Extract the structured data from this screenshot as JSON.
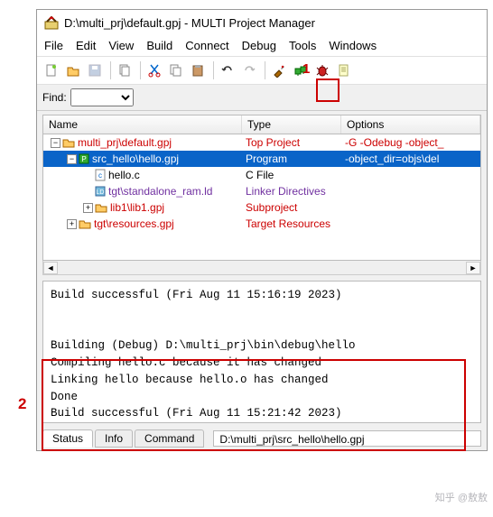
{
  "title": "D:\\multi_prj\\default.gpj - MULTI Project Manager",
  "menus": [
    "File",
    "Edit",
    "View",
    "Build",
    "Connect",
    "Debug",
    "Tools",
    "Windows"
  ],
  "toolbar_icons": [
    {
      "name": "new-file-icon",
      "disabled": false
    },
    {
      "name": "open-icon",
      "disabled": false
    },
    {
      "name": "save-icon",
      "disabled": true
    },
    {
      "name": "sep"
    },
    {
      "name": "copy-doc-icon",
      "disabled": false
    },
    {
      "name": "sep"
    },
    {
      "name": "cut-icon",
      "disabled": false
    },
    {
      "name": "copy-icon",
      "disabled": false
    },
    {
      "name": "paste-icon",
      "disabled": false
    },
    {
      "name": "sep"
    },
    {
      "name": "undo-icon",
      "disabled": false
    },
    {
      "name": "redo-icon",
      "disabled": true
    },
    {
      "name": "sep"
    },
    {
      "name": "build-icon",
      "disabled": false
    },
    {
      "name": "debug-icon",
      "disabled": false
    },
    {
      "name": "bug-icon",
      "disabled": false
    },
    {
      "name": "edit-doc-icon",
      "disabled": false
    }
  ],
  "find_label": "Find:",
  "columns": {
    "name": "Name",
    "type": "Type",
    "options": "Options"
  },
  "tree": [
    {
      "indent": 0,
      "twist": "-",
      "icon": "folder",
      "label": "multi_prj\\default.gpj",
      "type": "Top Project",
      "opt": "-G -Odebug -object_",
      "color": "red",
      "sel": false
    },
    {
      "indent": 1,
      "twist": "-",
      "icon": "prog",
      "label": "src_hello\\hello.gpj",
      "type": "Program",
      "opt": "-object_dir=objs\\del",
      "color": "white",
      "sel": true
    },
    {
      "indent": 2,
      "twist": "",
      "icon": "cfile",
      "label": "hello.c",
      "type": "C File",
      "opt": "",
      "color": "blk",
      "sel": false
    },
    {
      "indent": 2,
      "twist": "",
      "icon": "ldfile",
      "label": "tgt\\standalone_ram.ld",
      "type": "Linker Directives",
      "opt": "",
      "color": "purp",
      "sel": false
    },
    {
      "indent": 2,
      "twist": "+",
      "icon": "folder",
      "label": "lib1\\lib1.gpj",
      "type": "Subproject",
      "opt": "",
      "color": "red",
      "sel": false
    },
    {
      "indent": 1,
      "twist": "+",
      "icon": "folder",
      "label": "tgt\\resources.gpj",
      "type": "Target Resources",
      "opt": "",
      "color": "red",
      "sel": false
    }
  ],
  "output_lines": [
    "Build successful (Fri Aug 11 15:16:19 2023)",
    "",
    "",
    "Building (Debug) D:\\multi_prj\\bin\\debug\\hello",
    "Compiling hello.c because it has changed",
    "Linking hello because hello.o has changed",
    "Done",
    "Build successful (Fri Aug 11 15:21:42 2023)"
  ],
  "tabs": [
    {
      "label": "Status",
      "active": true
    },
    {
      "label": "Info",
      "active": false
    },
    {
      "label": "Command",
      "active": false
    }
  ],
  "path_display": "D:\\multi_prj\\src_hello\\hello.gpj",
  "callouts": {
    "one": "1",
    "two": "2"
  },
  "watermark": "知乎 @敖敖"
}
